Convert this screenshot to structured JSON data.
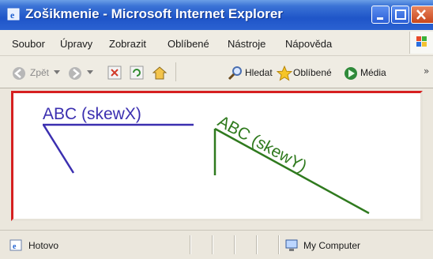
{
  "window": {
    "title": "Zošikmenie - Microsoft Internet Explorer"
  },
  "menu": {
    "items": [
      "Soubor",
      "Úpravy",
      "Zobrazit",
      "Oblíbené",
      "Nástroje",
      "Nápověda"
    ]
  },
  "toolbar": {
    "back_label": "Zpět",
    "search_label": "Hledat",
    "favorites_label": "Oblíbené",
    "media_label": "Média",
    "overflow": "»"
  },
  "content": {
    "skewx_text": "ABC (skewX)",
    "skewy_text": "ABC (skewY)",
    "skewx_color": "#3b2fb0",
    "skewy_color": "#2f7a1e"
  },
  "status": {
    "text": "Hotovo",
    "zone": "My Computer"
  },
  "icons": {
    "app": "ie-icon",
    "back": "back-arrow-icon",
    "forward": "forward-arrow-icon",
    "stop": "stop-icon",
    "refresh": "refresh-icon",
    "home": "home-icon",
    "search": "search-icon",
    "favorites": "star-icon",
    "media": "media-icon"
  }
}
